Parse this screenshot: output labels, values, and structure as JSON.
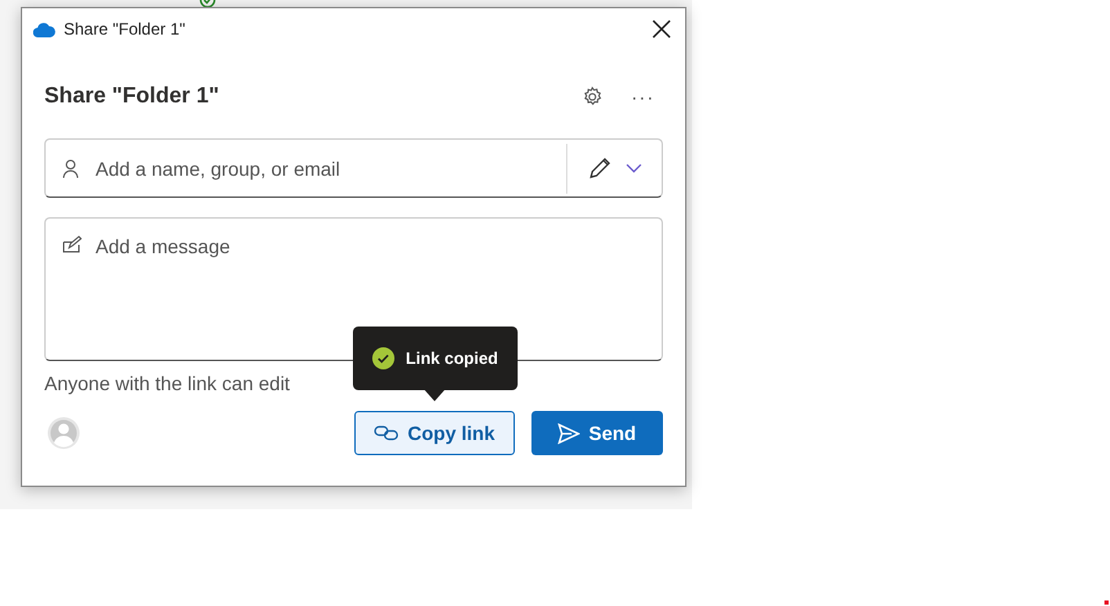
{
  "window": {
    "title": "Share \"Folder 1\""
  },
  "dialog": {
    "heading": "Share \"Folder 1\"",
    "more": "···"
  },
  "recipients": {
    "placeholder": "Add a name, group, or email"
  },
  "message": {
    "placeholder": "Add a message"
  },
  "link_setting": "Anyone with the link can edit",
  "tooltip": {
    "text": "Link copied"
  },
  "buttons": [
    {
      "kind": "secondary",
      "label": "Copy link"
    },
    {
      "kind": "primary",
      "label": "Send"
    }
  ]
}
